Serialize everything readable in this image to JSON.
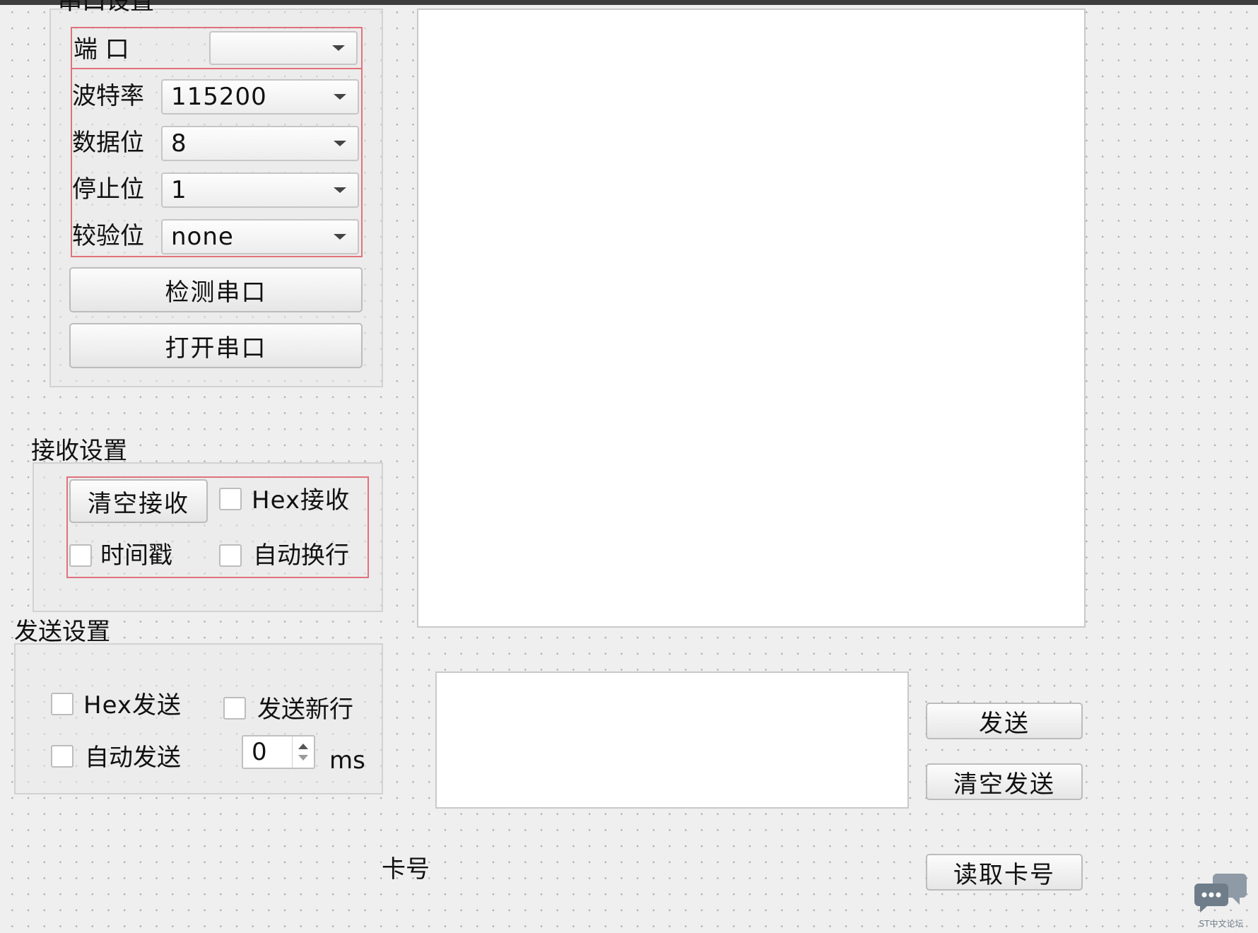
{
  "serial_group": {
    "title": "串口设置",
    "port_label": "端 口",
    "port_value": "",
    "baud_label": "波特率",
    "baud_value": "115200",
    "databits_label": "数据位",
    "databits_value": "8",
    "stopbits_label": "停止位",
    "stopbits_value": "1",
    "parity_label": "较验位",
    "parity_value": "none",
    "detect_button": "检测串口",
    "open_button": "打开串口"
  },
  "receive_group": {
    "title": "接收设置",
    "clear_button": "清空接收",
    "hex_receive": "Hex接收",
    "timestamp": "时间戳",
    "auto_newline": "自动换行"
  },
  "send_group": {
    "title": "发送设置",
    "hex_send": "Hex发送",
    "send_newline": "发送新行",
    "auto_send": "自动发送",
    "interval_value": "0",
    "interval_unit": "ms"
  },
  "send_panel": {
    "send_button": "发送",
    "clear_send_button": "清空发送"
  },
  "card": {
    "label": "卡号",
    "read_button": "读取卡号"
  },
  "watermark": {
    "text": "ST中文论坛"
  },
  "colors": {
    "highlight_border": "#e0727b",
    "background": "#efefef"
  }
}
